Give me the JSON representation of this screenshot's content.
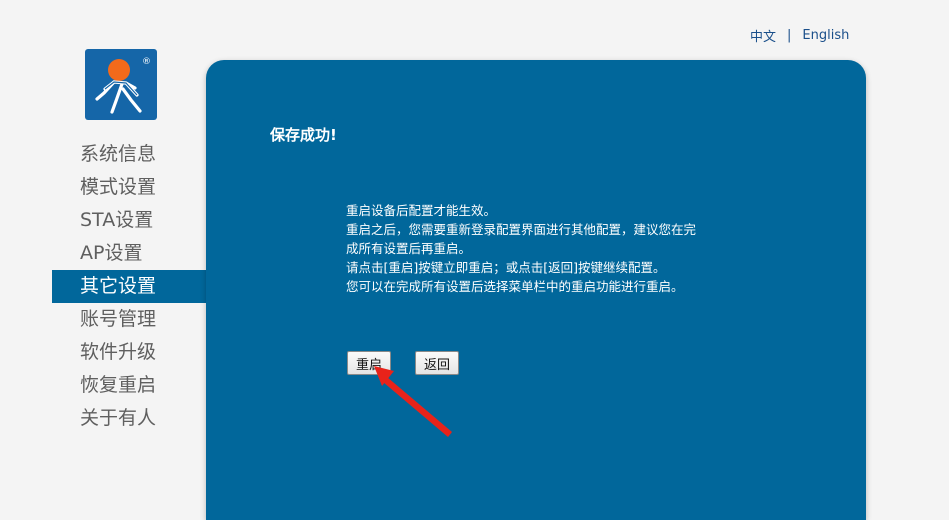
{
  "lang": {
    "zh": "中文",
    "separator": "|",
    "en": "English"
  },
  "logo": {
    "icon": "running-man-logo-icon",
    "registered_mark": "®",
    "bg_color": "#1566a8",
    "head_color": "#f26a1b"
  },
  "sidebar": {
    "items": [
      {
        "label": "系统信息",
        "active": false
      },
      {
        "label": "模式设置",
        "active": false
      },
      {
        "label": "STA设置",
        "active": false
      },
      {
        "label": "AP设置",
        "active": false
      },
      {
        "label": "其它设置",
        "active": true
      },
      {
        "label": "账号管理",
        "active": false
      },
      {
        "label": "软件升级",
        "active": false
      },
      {
        "label": "恢复重启",
        "active": false
      },
      {
        "label": "关于有人",
        "active": false
      }
    ]
  },
  "panel": {
    "bg_color": "#01679b",
    "title": "保存成功!",
    "lines": [
      "重启设备后配置才能生效。",
      "重启之后，您需要重新登录配置界面进行其他配置，建议您在完",
      "成所有设置后再重启。",
      "请点击[重启]按键立即重启；或点击[返回]按键继续配置。",
      "您可以在完成所有设置后选择菜单栏中的重启功能进行重启。"
    ],
    "buttons": {
      "reboot": "重启",
      "back": "返回"
    }
  },
  "annotation": {
    "arrow_color": "#e8231a"
  }
}
